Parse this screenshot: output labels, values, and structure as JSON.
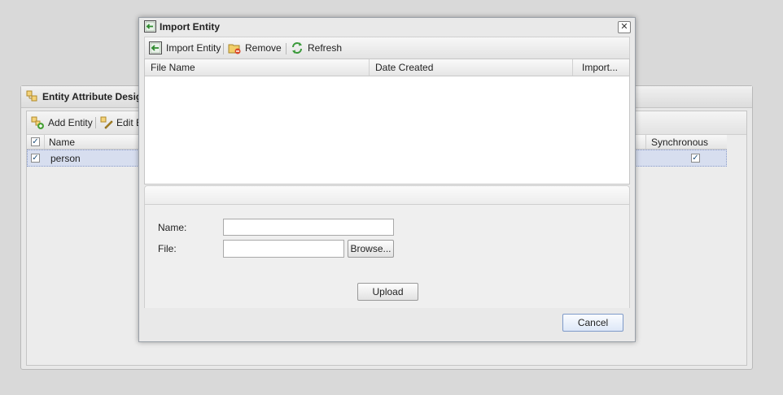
{
  "background_panel": {
    "title": "Entity Attribute Desig",
    "toolbar": {
      "add_label": "Add Entity",
      "edit_label": "Edit E"
    },
    "columns": {
      "name": "Name",
      "synchronous": "Synchronous"
    },
    "rows": [
      {
        "name": "person",
        "checked": true,
        "synchronous": true
      }
    ]
  },
  "dialog": {
    "title": "Import Entity",
    "close_glyph": "✕",
    "toolbar": {
      "import_label": "Import Entity",
      "remove_label": "Remove",
      "refresh_label": "Refresh"
    },
    "grid_columns": [
      "File Name",
      "Date Created",
      "Import..."
    ],
    "form": {
      "name_label": "Name:",
      "name_value": "",
      "file_label": "File:",
      "file_value": "",
      "browse_label": "Browse...",
      "upload_label": "Upload"
    },
    "cancel_label": "Cancel"
  },
  "icons": {
    "entity": "entity-icon",
    "add": "add-entity-icon",
    "edit": "edit-icon",
    "import": "import-icon",
    "remove": "remove-icon",
    "refresh": "refresh-icon"
  },
  "colors": {
    "selection": "#d7deef",
    "accent": "#7e9ac9"
  }
}
